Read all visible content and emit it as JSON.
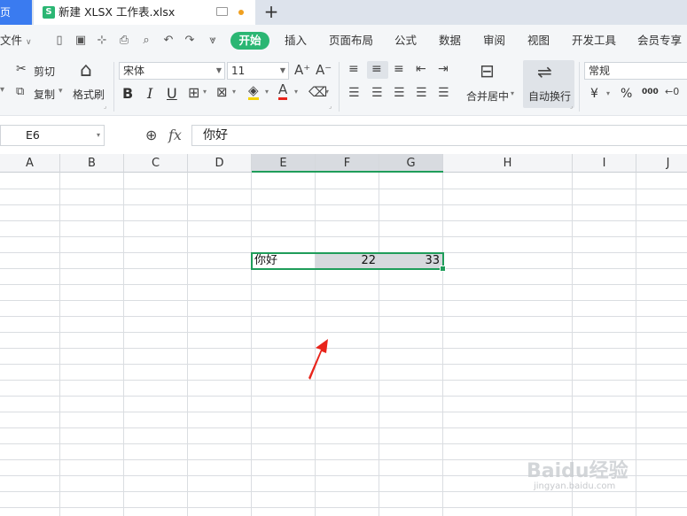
{
  "tabs": {
    "home_label": "页",
    "file_name": "新建 XLSX 工作表.xlsx",
    "file_icon": "S"
  },
  "menu": {
    "file_label": "文件",
    "items": [
      "开始",
      "插入",
      "页面布局",
      "公式",
      "数据",
      "审阅",
      "视图",
      "开发工具",
      "会员专享"
    ]
  },
  "ribbon": {
    "cut_label": "剪切",
    "copy_label": "复制",
    "format_painter_label": "格式刷",
    "font_name": "宋体",
    "font_size": "11",
    "bold": "B",
    "italic": "I",
    "underline": "U",
    "merge_label": "合并居中",
    "wrap_label": "自动换行",
    "number_format": "常规",
    "currency_symbol": "¥",
    "percent_symbol": "%",
    "thousands_symbol": "000"
  },
  "formula_bar": {
    "cell_ref": "E6",
    "fx_label": "fx",
    "content": "你好"
  },
  "grid": {
    "columns": [
      "A",
      "B",
      "C",
      "D",
      "E",
      "F",
      "G",
      "H",
      "I",
      "J"
    ],
    "cells": {
      "E6": "你好",
      "F6": "22",
      "G6": "33"
    }
  },
  "watermark": {
    "brand": "Baidu经验",
    "url": "jingyan.baidu.com"
  },
  "colors": {
    "accent_green": "#2bb673",
    "selection_green": "#1f9d5a",
    "arrow_red": "#e8241b"
  }
}
